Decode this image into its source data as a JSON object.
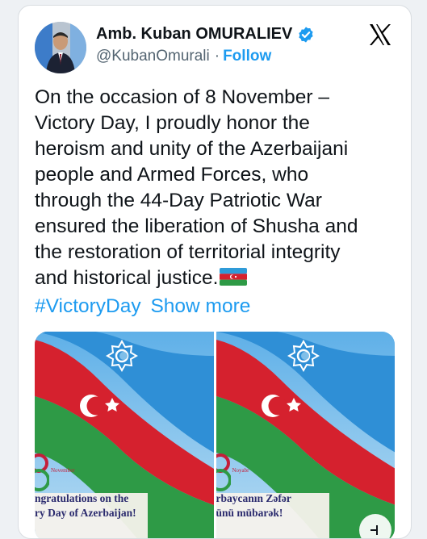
{
  "author": {
    "name": "Amb. Kuban OMURALIEV",
    "handle": "@KubanOmurali",
    "separator": "·",
    "follow_label": "Follow"
  },
  "platform_icon": "x-logo-icon",
  "verified_icon": "verified-badge-icon",
  "tweet": {
    "body": "On the occasion of 8 November –\nVictory Day, I proudly honor the\nheroism and unity of the Azerbaijani\npeople and Armed Forces, who\nthrough the 44-Day Patriotic War\nensured the liberation of Shusha and\nthe restoration of territorial integrity\nand historical justice.",
    "emoji": "azerbaijan-flag-emoji",
    "hashtag": "#VictoryDay",
    "show_more_label": "Show more"
  },
  "media": [
    {
      "month": "November",
      "caption": "ngratulations on the\nry Day of Azerbaijan!"
    },
    {
      "month": "Noyabr",
      "caption": "rbaycanın Zəfər\nünü mübarək!"
    }
  ],
  "colors": {
    "accent": "#1d9bf0",
    "text": "#0f1419",
    "secondary": "#536471",
    "flag_blue": "#2f9bd8",
    "flag_red": "#d5212e",
    "flag_green": "#2e9a46"
  }
}
